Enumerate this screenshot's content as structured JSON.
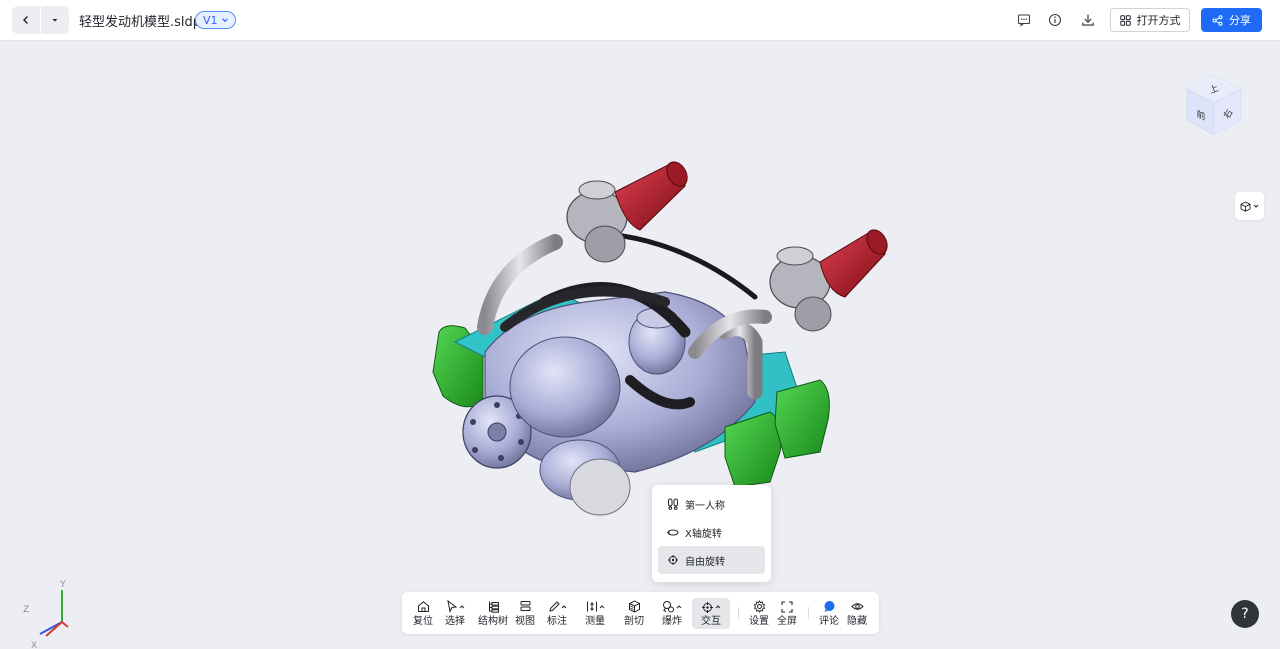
{
  "header": {
    "file_name": "轻型发动机模型.sldprt",
    "version": "V1",
    "open_with_label": "打开方式",
    "share_label": "分享",
    "icons": [
      "back-icon",
      "dropdown-icon",
      "comment-icon",
      "info-icon",
      "download-icon",
      "grid-icon",
      "share-icon"
    ]
  },
  "view_cube": {
    "faces": [
      "上",
      "前",
      "右"
    ]
  },
  "axis": {
    "x": "X",
    "y": "Y",
    "z": "Z"
  },
  "interaction_menu": {
    "items": [
      {
        "label": "第一人称",
        "icon": "footprints-icon",
        "active": false
      },
      {
        "label": "X轴旋转",
        "icon": "x-rotate-icon",
        "active": false
      },
      {
        "label": "自由旋转",
        "icon": "free-rotate-icon",
        "active": true
      }
    ]
  },
  "toolbar": {
    "items": [
      {
        "label": "复位",
        "icon": "home-icon"
      },
      {
        "label": "选择",
        "icon": "cursor-icon"
      },
      {
        "label": "结构树",
        "icon": "tree-icon"
      },
      {
        "label": "视图",
        "icon": "layers-icon"
      },
      {
        "label": "标注",
        "icon": "pen-icon"
      },
      {
        "label": "测量",
        "icon": "measure-icon"
      },
      {
        "label": "剖切",
        "icon": "section-cube-icon"
      },
      {
        "label": "爆炸",
        "icon": "explode-icon"
      },
      {
        "label": "交互",
        "icon": "interact-icon",
        "active": true
      },
      {
        "label": "设置",
        "icon": "gear-icon"
      },
      {
        "label": "全屏",
        "icon": "fullscreen-icon"
      },
      {
        "label": "评论",
        "icon": "comment-dot-icon"
      },
      {
        "label": "隐藏",
        "icon": "eye-icon"
      }
    ]
  },
  "help_label": "?",
  "colors": {
    "primary": "#1e6cf5",
    "background": "#eceef3",
    "engine_body": "#aeb2d8",
    "valve_cover": "#2fb52f",
    "intake_filter": "#b71c2a",
    "cooling_fins": "#2ec4c9"
  }
}
